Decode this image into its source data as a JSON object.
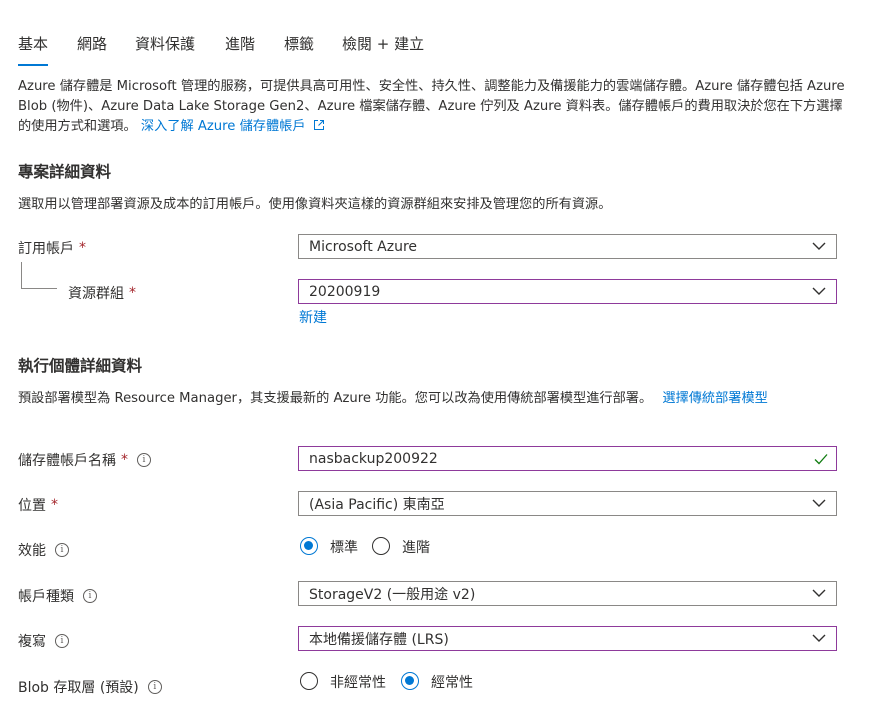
{
  "tabs": [
    "基本",
    "網路",
    "資料保護",
    "進階",
    "標籤",
    "檢閱 + 建立"
  ],
  "description": {
    "text": "Azure 儲存體是 Microsoft 管理的服務，可提供具高可用性、安全性、持久性、調整能力及備援能力的雲端儲存體。Azure 儲存體包括 Azure Blob (物件)、Azure Data Lake Storage Gen2、Azure 檔案儲存體、Azure 佇列及 Azure 資料表。儲存體帳戶的費用取決於您在下方選擇的使用方式和選項。",
    "link": "深入了解 Azure 儲存體帳戶"
  },
  "project": {
    "heading": "專案詳細資料",
    "subtitle": "選取用以管理部署資源及成本的訂用帳戶。使用像資料夾這樣的資源群組來安排及管理您的所有資源。",
    "subscription_label": "訂用帳戶",
    "subscription_value": "Microsoft Azure",
    "resource_group_label": "資源群組",
    "resource_group_value": "20200919",
    "new_link": "新建"
  },
  "instance": {
    "heading": "執行個體詳細資料",
    "subtitle": "預設部署模型為 Resource Manager，其支援最新的 Azure 功能。您可以改為使用傳統部署模型進行部署。",
    "classic_link": "選擇傳統部署模型",
    "name_label": "儲存體帳戶名稱",
    "name_value": "nasbackup200922",
    "location_label": "位置",
    "location_value": "(Asia Pacific) 東南亞",
    "performance_label": "效能",
    "performance_options": [
      "標準",
      "進階"
    ],
    "performance_selected": "標準",
    "kind_label": "帳戶種類",
    "kind_value": "StorageV2 (一般用途 v2)",
    "replication_label": "複寫",
    "replication_value": "本地備援儲存體 (LRS)",
    "tier_label": "Blob 存取層 (預設)",
    "tier_options": [
      "非經常性",
      "經常性"
    ],
    "tier_selected": "經常性"
  },
  "required_mark": "*",
  "info_glyph": "i",
  "colors": {
    "accent": "#0078d4",
    "focus_border": "#8e3a9b",
    "required": "#a4262c",
    "valid": "#107c10"
  }
}
